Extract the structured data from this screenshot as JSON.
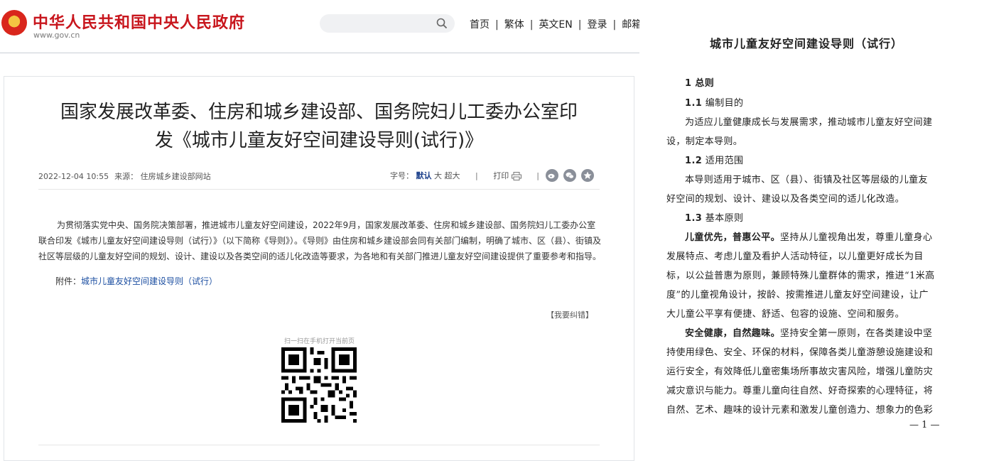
{
  "header": {
    "site_title": "中华人民共和国中央人民政府",
    "site_url": "www.gov.cn",
    "nav": [
      "首页",
      "繁体",
      "英文EN",
      "登录",
      "邮箱"
    ],
    "nav_separator": "|"
  },
  "article": {
    "title_line1": "国家发展改革委、住房和城乡建设部、国务院妇儿工委办公室印",
    "title_line2": "发《城市儿童友好空间建设导则(试行)》",
    "datetime": "2022-12-04 10:55",
    "source": "来源： 住房城乡建设部网站",
    "font_size_label": "字号：",
    "font_sizes": [
      "默认",
      "大",
      "超大"
    ],
    "print_label": "打印",
    "separator": "|",
    "body": "为贯彻落实党中央、国务院决策部署，推进城市儿童友好空间建设，2022年9月，国家发展改革委、住房和城乡建设部、国务院妇儿工委办公室联合印发《城市儿童友好空间建设导则（试行）》（以下简称《导则》）。《导则》由住房和城乡建设部会同有关部门编制，明确了城市、区（县）、街镇及社区等层级的儿童友好空间的规划、设计、建设以及各类空间的适儿化改造等要求，为各地和有关部门推进儿童友好空间建设提供了重要参考和指导。",
    "attachment_label": "附件：",
    "attachment_link": "城市儿童友好空间建设导则（试行）",
    "correction": "【我要纠错】",
    "qr_caption": "扫一扫在手机打开当前页"
  },
  "document": {
    "title": "城市儿童友好空间建设导则（试行）",
    "h1": "1 总则",
    "s1_num": "1.1",
    "s1_title": "编制目的",
    "p1_l1": "为适应儿童健康成长与发展需求，推动城市儿童友好空间建",
    "p1_l2": "设，制定本导则。",
    "s2_num": "1.2",
    "s2_title": "适用范围",
    "p2_l1": "本导则适用于城市、区（县）、街镇及社区等层级的儿童友",
    "p2_l2": "好空间的规划、设计、建设以及各类空间的适儿化改造。",
    "s3_num": "1.3",
    "s3_title": "基本原则",
    "p3_bold": "儿童优先，普惠公平。",
    "p3_l1": "坚持从儿童视角出发，尊重儿童身心",
    "p3_l2": "发展特点、考虑儿童及看护人活动特征，以儿童更好成长为目",
    "p3_l3": "标，以公益普惠为原则，兼顾特殊儿童群体的需求，推进“1米高",
    "p3_l4": "度”的儿童视角设计，按龄、按需推进儿童友好空间建设，让广",
    "p3_l5": "大儿童公平享有便捷、舒适、包容的设施、空间和服务。",
    "p4_bold": "安全健康，自然趣味。",
    "p4_l1": "坚持安全第一原则，在各类建设中坚",
    "p4_l2": "持使用绿色、安全、环保的材料，保障各类儿童游憩设施建设和",
    "p4_l3": "运行安全，有效降低儿童密集场所事故灾害风险，增强儿童防灾",
    "p4_l4": "减灾意识与能力。尊重儿童向往自然、好奇探索的心理特征，将",
    "p4_l5": "自然、艺术、趣味的设计元素和激发儿童创造力、想象力的色彩",
    "page_number": "— 1 —"
  }
}
